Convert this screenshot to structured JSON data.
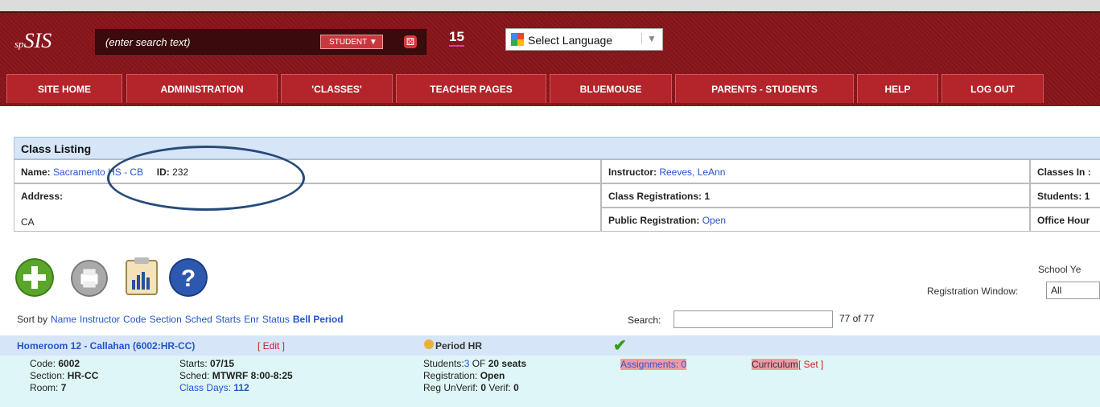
{
  "header": {
    "logo_prefix": "sp",
    "logo_main": "SIS",
    "search_placeholder": "(enter search text)",
    "search_type": "STUDENT",
    "badge_number": "15",
    "language_label": "Select Language"
  },
  "nav": {
    "tabs": [
      "SITE HOME",
      "ADMINISTRATION",
      "'CLASSES'",
      "TEACHER PAGES",
      "BLUEMOUSE",
      "PARENTS - STUDENTS",
      "HELP",
      "LOG OUT"
    ]
  },
  "class_listing": {
    "title": "Class Listing",
    "name_label": "Name:",
    "name_value": "Sacramento HS - CB",
    "id_label": "ID:",
    "id_value": "232",
    "address_label": "Address:",
    "address_value": "CA",
    "instructor_label": "Instructor:",
    "instructor_value": "Reeves, LeAnn",
    "class_reg_label": "Class Registrations:",
    "class_reg_value": "1",
    "public_reg_label": "Public Registration:",
    "public_reg_value": "Open",
    "classes_in_label": "Classes In :",
    "students_label": "Students: 1",
    "office_hours_label": "Office Hour"
  },
  "toolbar": {
    "school_year_label": "School Ye",
    "reg_window_label": "Registration Window:",
    "reg_window_value": "All"
  },
  "sort": {
    "prefix": "Sort by",
    "options": [
      "Name",
      "Instructor",
      "Code",
      "Section",
      "Sched",
      "Starts",
      "Enr",
      "Status"
    ],
    "bell_period": "Bell Period"
  },
  "search": {
    "label": "Search:",
    "value": "",
    "count": "77 of 77"
  },
  "class_row": {
    "title": "Homeroom 12 - Callahan (6002:HR-CC)",
    "edit": "[ Edit ]",
    "period": "Period HR",
    "code_label": "Code:",
    "code_value": "6002",
    "section_label": "Section:",
    "section_value": "HR-CC",
    "room_label": "Room:",
    "room_value": "7",
    "starts_label": "Starts:",
    "starts_value": "07/15",
    "sched_label": "Sched:",
    "sched_value": "MTWRF 8:00-8:25",
    "class_days_label": "Class Days:",
    "class_days_value": "112",
    "students_label": "Students:",
    "students_count": "3",
    "students_rest": "OF",
    "students_seats": "20 seats",
    "registration_label": "Registration:",
    "registration_value": "Open",
    "reg_unverif_label": "Reg UnVerif:",
    "reg_unverif_value": "0",
    "verif_label": "Verif:",
    "verif_value": "0",
    "assignments": "Assignments: 0",
    "curriculum": "Curriculum",
    "curriculum_set": "[ Set ]"
  },
  "colors": {
    "header_red": "#8e1a1f",
    "tab_red": "#b3252b",
    "link_blue": "#2255cc",
    "row_header_blue": "#d6e6f8",
    "row_body_cyan": "#dff6f6"
  }
}
